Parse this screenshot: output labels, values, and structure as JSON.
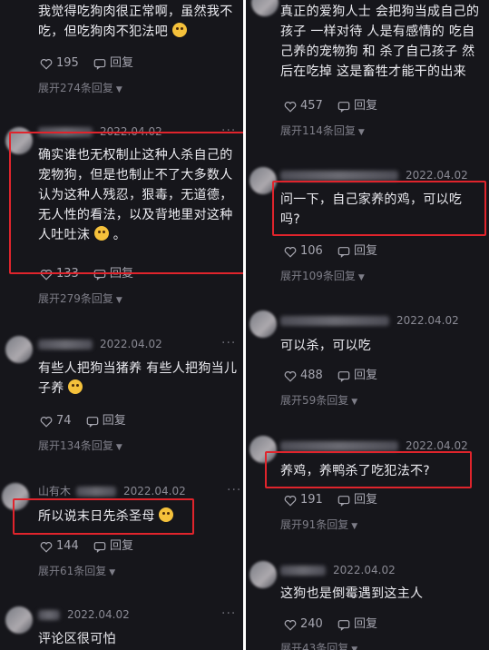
{
  "left": [
    {
      "text_lines": [
        "我觉得吃狗肉很正常啊，虽然我不",
        "吃，但吃狗肉不犯法吧"
      ],
      "emoji": "laugh-cry-emoji",
      "likes": "195",
      "reply": "回复",
      "expand": "展开274条回复"
    },
    {
      "date": "2022.04.02",
      "text_lines": [
        "确实谁也无权制止这种人杀自己的",
        "宠物狗，但是也制止不了大多数人",
        "认为这种人残忍，狠毒，无道德，",
        "无人性的看法，以及背地里对这种",
        "人吐吐沫"
      ],
      "text_suffix": "。",
      "emoji": "smile-emoji",
      "likes": "133",
      "reply": "回复",
      "expand": "展开279条回复"
    },
    {
      "date": "2022.04.02",
      "text_lines": [
        "有些人把狗当猪养 有些人把狗当儿",
        "子养"
      ],
      "emoji": "laugh-emoji",
      "likes": "74",
      "reply": "回复",
      "expand": "展开134条回复"
    },
    {
      "name_fragment": "山有木",
      "date": "2022.04.02",
      "text_lines": [
        "所以说末日先杀圣母"
      ],
      "emoji": "laugh-emoji",
      "likes": "144",
      "reply": "回复",
      "expand": "展开61条回复"
    },
    {
      "date": "2022.04.02",
      "text_lines": [
        "评论区很可怕"
      ]
    }
  ],
  "right": [
    {
      "text_lines": [
        "真正的爱狗人士 会把狗当成自己的",
        "孩子 一样对待 人是有感情的 吃自",
        "己养的宠物狗 和 杀了自己孩子 然",
        "后在吃掉 这是畜牲才能干的出来"
      ],
      "likes": "457",
      "reply": "回复",
      "expand": "展开114条回复"
    },
    {
      "date": "2022.04.02",
      "text_lines": [
        "问一下，自己家养的鸡，可以吃",
        "吗?"
      ],
      "likes": "106",
      "reply": "回复",
      "expand": "展开109条回复"
    },
    {
      "date": "2022.04.02",
      "text_lines": [
        "可以杀，可以吃"
      ],
      "likes": "488",
      "reply": "回复",
      "expand": "展开59条回复"
    },
    {
      "date": "2022.04.02",
      "text_lines": [
        "养鸡，养鸭杀了吃犯法不?"
      ],
      "likes": "191",
      "reply": "回复",
      "expand": "展开91条回复"
    },
    {
      "date": "2022.04.02",
      "text_lines": [
        "这狗也是倒霉遇到这主人"
      ],
      "likes": "240",
      "reply": "回复",
      "expand": "展开43条回复"
    }
  ],
  "colors": {
    "highlight": "#e0242c",
    "background": "#16161b"
  }
}
